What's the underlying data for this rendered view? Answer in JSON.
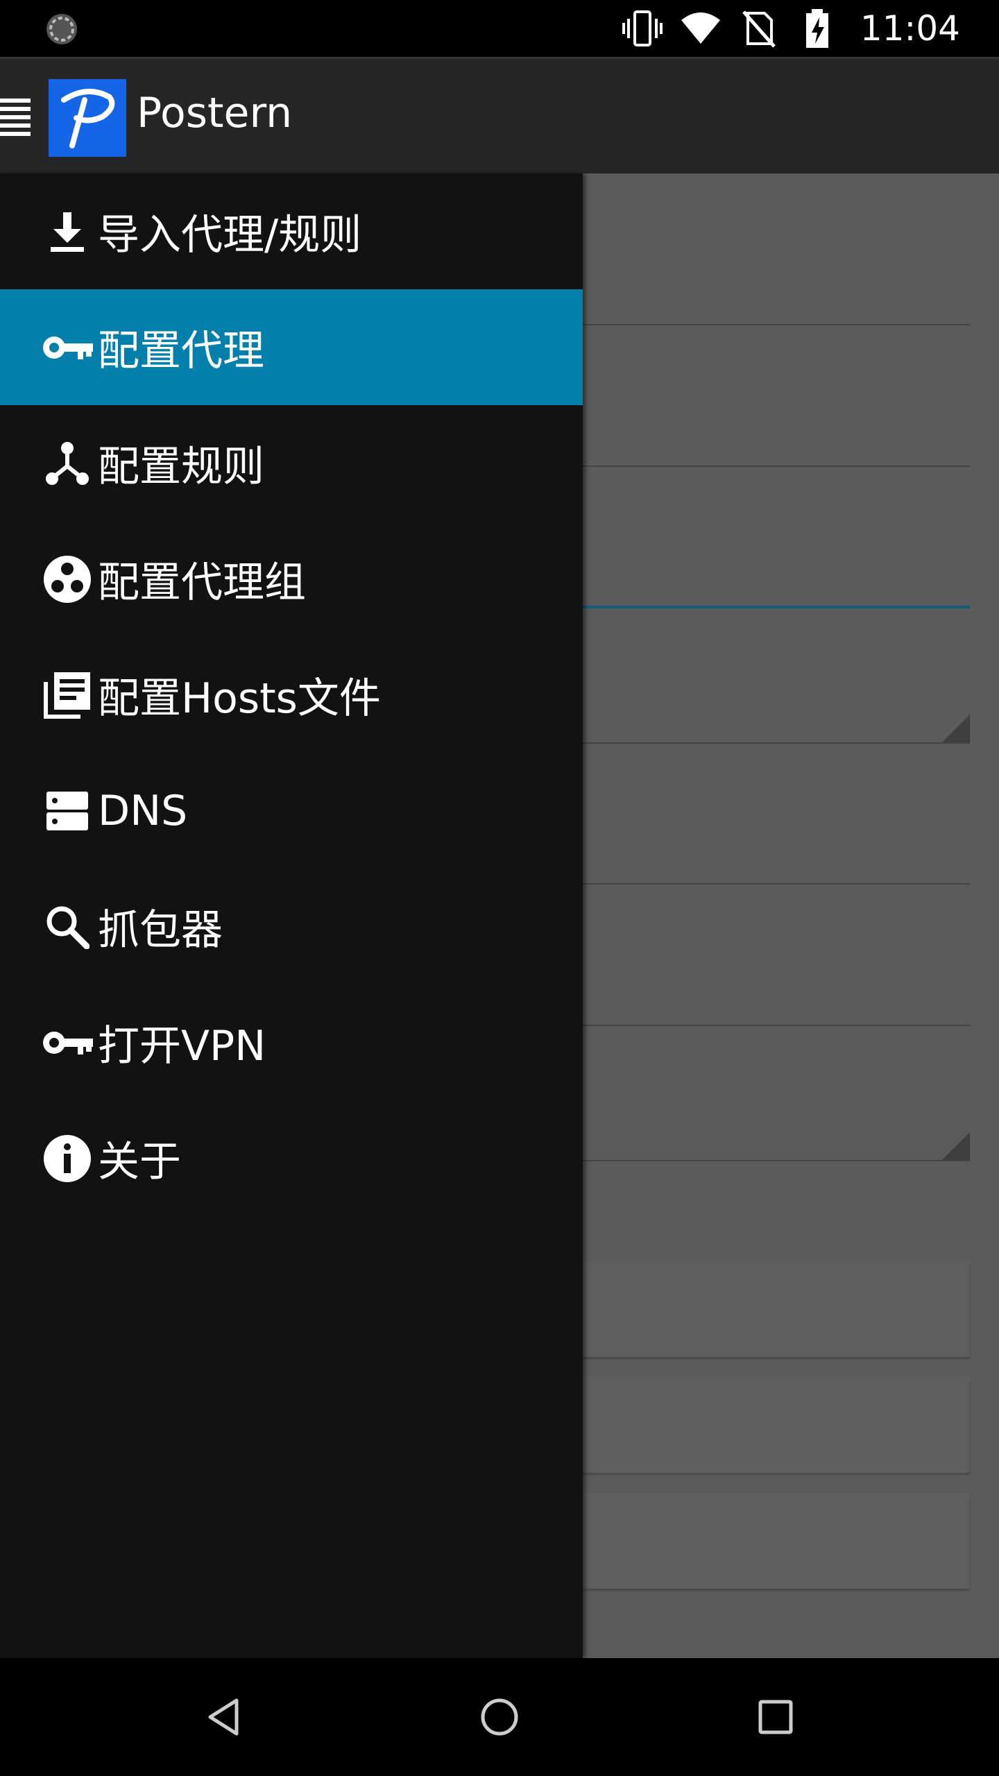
{
  "status_bar": {
    "time": "11:04",
    "icons": [
      "sync-icon",
      "vibrate-icon",
      "wifi-icon",
      "no-sim-icon",
      "battery-charging-icon"
    ]
  },
  "app_bar": {
    "title": "Postern",
    "menu_icon": "hamburger-icon",
    "logo_icon": "postern-logo"
  },
  "drawer": {
    "items": [
      {
        "label": "导入代理/规则",
        "icon": "download-icon",
        "selected": false
      },
      {
        "label": "配置代理",
        "icon": "key-icon",
        "selected": true
      },
      {
        "label": "配置规则",
        "icon": "rules-fork-icon",
        "selected": false
      },
      {
        "label": "配置代理组",
        "icon": "group-circles-icon",
        "selected": false
      },
      {
        "label": "配置Hosts文件",
        "icon": "document-list-icon",
        "selected": false
      },
      {
        "label": "DNS",
        "icon": "dns-server-icon",
        "selected": false
      },
      {
        "label": "抓包器",
        "icon": "search-icon",
        "selected": false
      },
      {
        "label": "打开VPN",
        "icon": "vpn-key-icon",
        "selected": false
      },
      {
        "label": "关于",
        "icon": "info-icon",
        "selected": false
      }
    ]
  },
  "colors": {
    "selected_item": "#037fab",
    "drawer_bg": "#121212",
    "app_bar_bg": "#262626",
    "logo_bg": "#1565e8"
  },
  "nav_bar": {
    "buttons": [
      "back-icon",
      "home-icon",
      "recents-icon"
    ]
  }
}
